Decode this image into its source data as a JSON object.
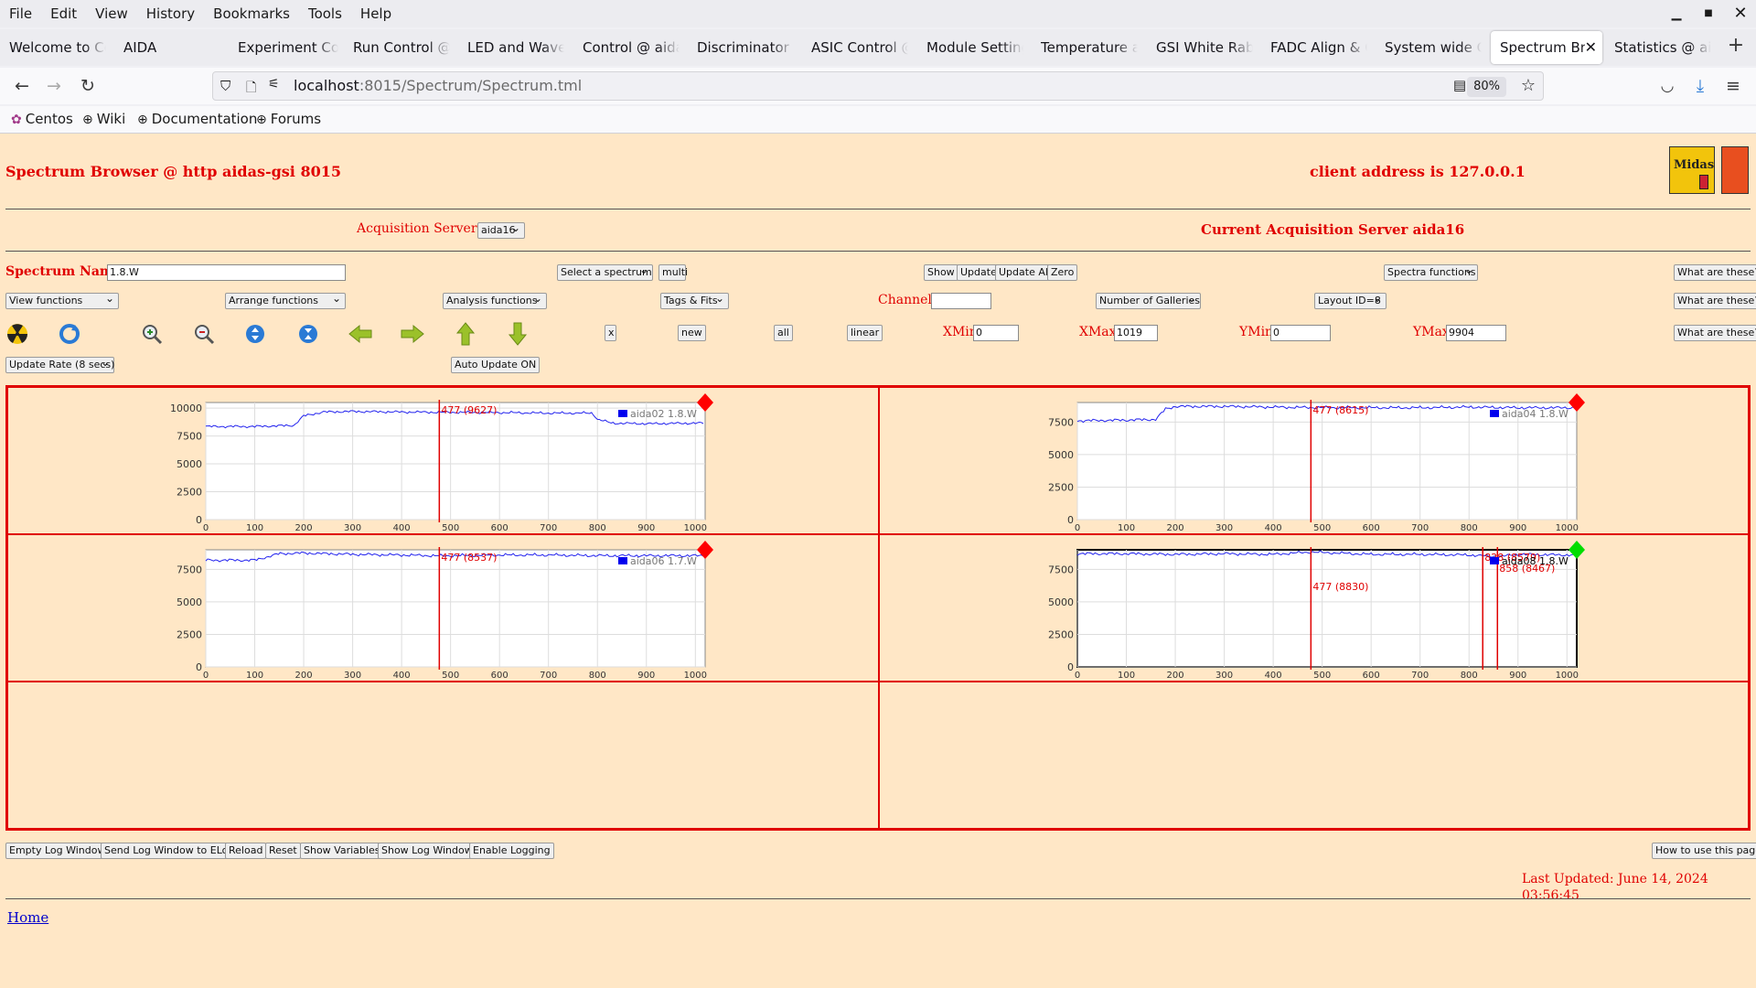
{
  "menu": [
    "File",
    "Edit",
    "View",
    "History",
    "Bookmarks",
    "Tools",
    "Help"
  ],
  "tabs": [
    "Welcome to Ce",
    "AIDA",
    "Experiment Cont",
    "Run Control @ a",
    "LED and Wavefo",
    "Control @ aidas",
    "Discriminator co",
    "ASIC Control @",
    "Module Settings",
    "Temperature an",
    "GSI White Rabbi",
    "FADC Align & C",
    "System wide Ch",
    "Spectrum Bro",
    "Statistics @ aid"
  ],
  "url": {
    "host": "localhost",
    "path": ":8015/Spectrum/Spectrum.tml"
  },
  "zoom": "80%",
  "bookmarks": [
    "Centos",
    "Wiki",
    "Documentation",
    "Forums"
  ],
  "header": {
    "title": "Spectrum Browser @ http aidas-gsi 8015",
    "client": "client address is 127.0.0.1",
    "logo_text": "Midas"
  },
  "servers": {
    "label": "Acquisition Servers",
    "selected": "aida16",
    "current": "Current Acquisition Server aida16"
  },
  "controls": {
    "spectrum_name_label": "Spectrum Name:",
    "spectrum_name": "1.8.W",
    "select_spectrum": "Select a spectrum",
    "multi": "multi",
    "show": "Show",
    "update": "Update",
    "update_all": "Update All",
    "zero": "Zero",
    "spectra_functions": "Spectra functions",
    "what": "What are these?",
    "view_functions": "View functions",
    "arrange_functions": "Arrange functions",
    "analysis_functions": "Analysis functions",
    "tags_fits": "Tags & Fits",
    "channel_label": "Channel:",
    "channel": "",
    "galleries": "Number of Galleries",
    "layout": "Layout ID=8",
    "x_btn": "x",
    "new_btn": "new",
    "all_btn": "all",
    "linear_btn": "linear",
    "xmin_label": "XMin",
    "xmin": "0",
    "xmax_label": "XMax",
    "xmax": "1019",
    "ymin_label": "YMin",
    "ymin": "0",
    "ymax_label": "YMax",
    "ymax": "9904",
    "update_rate": "Update Rate (8 secs)",
    "auto_update": "Auto Update ON"
  },
  "toolbar_icons": [
    "radiation-icon",
    "refresh-icon",
    "zoom-in-icon",
    "zoom-out-icon",
    "expand-vertical-icon",
    "compress-vertical-icon",
    "arrow-left-icon",
    "arrow-right-icon",
    "arrow-up-icon",
    "arrow-down-icon"
  ],
  "chart_data": [
    {
      "type": "line",
      "legend": "aida02 1.8.W",
      "xlim": [
        0,
        1020
      ],
      "ylim": [
        0,
        10500
      ],
      "yticks": [
        0,
        2500,
        5000,
        7500,
        10000
      ],
      "xticks": [
        0,
        100,
        200,
        300,
        400,
        500,
        600,
        700,
        800,
        900,
        1000
      ],
      "points": [
        [
          0,
          8350
        ],
        [
          100,
          8350
        ],
        [
          180,
          8450
        ],
        [
          200,
          9300
        ],
        [
          240,
          9650
        ],
        [
          300,
          9700
        ],
        [
          400,
          9650
        ],
        [
          477,
          9627
        ],
        [
          600,
          9600
        ],
        [
          700,
          9550
        ],
        [
          790,
          9550
        ],
        [
          800,
          9000
        ],
        [
          830,
          8650
        ],
        [
          900,
          8600
        ],
        [
          1000,
          8650
        ],
        [
          1019,
          8650
        ]
      ],
      "marker": {
        "x": 477,
        "label": "477 (9627)"
      },
      "marker_color": "#ff0000"
    },
    {
      "type": "line",
      "legend": "aida04 1.8.W",
      "xlim": [
        0,
        1020
      ],
      "ylim": [
        0,
        9000
      ],
      "yticks": [
        0,
        2500,
        5000,
        7500
      ],
      "xticks": [
        0,
        100,
        200,
        300,
        400,
        500,
        600,
        700,
        800,
        900,
        1000
      ],
      "points": [
        [
          0,
          7600
        ],
        [
          100,
          7650
        ],
        [
          160,
          7700
        ],
        [
          180,
          8500
        ],
        [
          200,
          8700
        ],
        [
          300,
          8700
        ],
        [
          400,
          8650
        ],
        [
          477,
          8615
        ],
        [
          600,
          8600
        ],
        [
          700,
          8600
        ],
        [
          800,
          8650
        ],
        [
          900,
          8600
        ],
        [
          1000,
          8600
        ],
        [
          1019,
          8600
        ]
      ],
      "marker": {
        "x": 477,
        "label": "477 (8615)"
      },
      "marker_color": "#ff0000"
    },
    {
      "type": "line",
      "legend": "aida06 1.7.W",
      "xlim": [
        0,
        1020
      ],
      "ylim": [
        0,
        9000
      ],
      "yticks": [
        0,
        2500,
        5000,
        7500
      ],
      "xticks": [
        0,
        100,
        200,
        300,
        400,
        500,
        600,
        700,
        800,
        900,
        1000
      ],
      "points": [
        [
          0,
          8200
        ],
        [
          100,
          8200
        ],
        [
          120,
          8400
        ],
        [
          150,
          8700
        ],
        [
          200,
          8750
        ],
        [
          300,
          8650
        ],
        [
          400,
          8600
        ],
        [
          477,
          8537
        ],
        [
          600,
          8600
        ],
        [
          700,
          8600
        ],
        [
          800,
          8550
        ],
        [
          900,
          8550
        ],
        [
          1000,
          8550
        ],
        [
          1019,
          8550
        ]
      ],
      "marker": {
        "x": 477,
        "label": "477 (8537)"
      },
      "marker_color": "#ff0000"
    },
    {
      "type": "line",
      "legend": "aida08 1.8.W",
      "xlim": [
        0,
        1020
      ],
      "ylim": [
        0,
        9000
      ],
      "yticks": [
        0,
        2500,
        5000,
        7500
      ],
      "xticks": [
        0,
        100,
        200,
        300,
        400,
        500,
        600,
        700,
        800,
        900,
        1000
      ],
      "points": [
        [
          0,
          8700
        ],
        [
          100,
          8700
        ],
        [
          200,
          8650
        ],
        [
          300,
          8700
        ],
        [
          400,
          8650
        ],
        [
          477,
          8830
        ],
        [
          600,
          8650
        ],
        [
          700,
          8650
        ],
        [
          800,
          8600
        ],
        [
          858,
          8467
        ],
        [
          900,
          8650
        ],
        [
          1000,
          8600
        ],
        [
          1019,
          8600
        ]
      ],
      "marker": {
        "x": 477,
        "label": "477 (8830)"
      },
      "extra_markers": [
        {
          "x": 828,
          "label": "828 (8579)"
        },
        {
          "x": 858,
          "label": "858 (8467)"
        }
      ],
      "marker_color": "#00dd00",
      "selected": true
    }
  ],
  "bottom_buttons": [
    "Empty Log Window",
    "Send Log Window to ELog",
    "Reload",
    "Reset",
    "Show Variables",
    "Show Log Window",
    "Enable Logging"
  ],
  "how_to": "How to use this page",
  "last_updated": "Last Updated: June 14, 2024 03:56:45",
  "home_link": "Home",
  "colors": {
    "accent": "#e00000",
    "page_bg": "#ffe7c6",
    "trace": "#2222ee"
  }
}
